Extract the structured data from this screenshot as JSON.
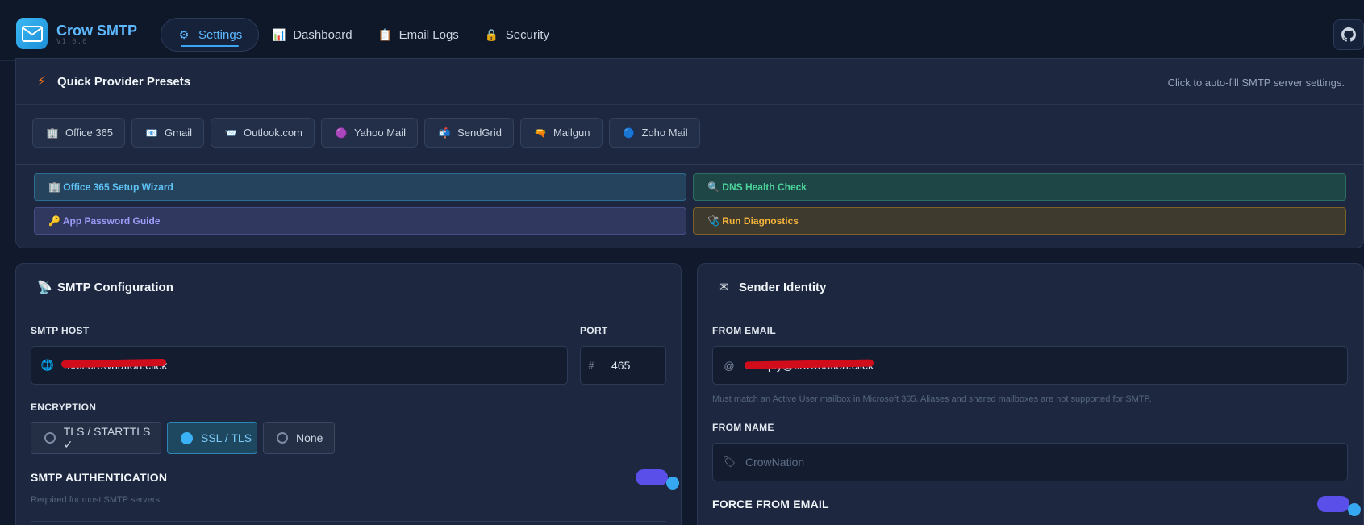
{
  "brand": {
    "name": "Crow SMTP",
    "version": "V1.0.0"
  },
  "nav": [
    {
      "label": "Settings",
      "icon": "⚙"
    },
    {
      "label": "Dashboard",
      "icon": "📊"
    },
    {
      "label": "Email Logs",
      "icon": "📋"
    },
    {
      "label": "Security",
      "icon": "🔒"
    }
  ],
  "presets": {
    "title": "Quick Provider Presets",
    "hint": "Click to auto-fill SMTP server settings.",
    "providers": [
      {
        "label": "Office 365",
        "icon": "🏢"
      },
      {
        "label": "Gmail",
        "icon": "📧"
      },
      {
        "label": "Outlook.com",
        "icon": "📨"
      },
      {
        "label": "Yahoo Mail",
        "icon": "🟣"
      },
      {
        "label": "SendGrid",
        "icon": "📬"
      },
      {
        "label": "Mailgun",
        "icon": "🔫"
      },
      {
        "label": "Zoho Mail",
        "icon": "🔵"
      }
    ],
    "tools": {
      "office_wizard": "🏢 Office 365 Setup Wizard",
      "dns_check": "🔍 DNS Health Check",
      "app_password": "🔑 App Password Guide",
      "diagnostics": "🩺 Run Diagnostics"
    }
  },
  "smtp": {
    "title": "SMTP Configuration",
    "host_label": "SMTP HOST",
    "host_value": "mail.crownation.click",
    "port_label": "PORT",
    "port_value": "465",
    "encryption_label": "ENCRYPTION",
    "encryption_options": [
      "TLS / STARTTLS ✓",
      "SSL / TLS",
      "None"
    ],
    "encryption_selected": "SSL / TLS",
    "auth_label": "SMTP AUTHENTICATION",
    "auth_hint": "Required for most SMTP servers.",
    "auth_enabled": true
  },
  "sender": {
    "title": "Sender Identity",
    "from_email_label": "FROM EMAIL",
    "from_email_value": "noreply@crownation.click",
    "from_email_hint": "Must match an Active User mailbox in Microsoft 365. Aliases and shared mailboxes are not supported for SMTP.",
    "from_name_label": "FROM NAME",
    "from_name_placeholder": "CrowNation",
    "force_label": "FORCE FROM EMAIL",
    "force_enabled": true
  },
  "colors": {
    "accent": "#3ba5f5",
    "toggle": "#5a4fe8",
    "background": "#111a2c"
  }
}
